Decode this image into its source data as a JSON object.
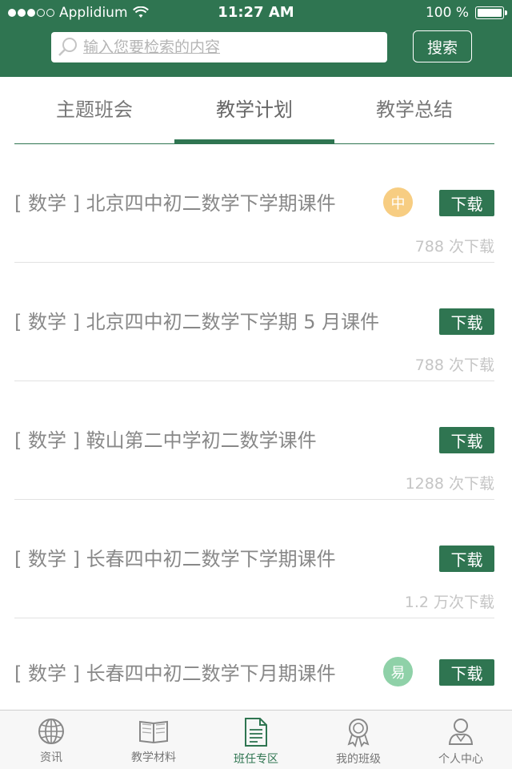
{
  "status_bar": {
    "carrier": "Applidium",
    "time": "11:27 AM",
    "battery": "100 %",
    "battery_level": 1.0,
    "signal_bars_filled": 3,
    "signal_bars_total": 5
  },
  "search": {
    "placeholder": "输入您要检索的内容",
    "button_label": "搜索"
  },
  "tabs": [
    {
      "label": "主题班会",
      "active": false
    },
    {
      "label": "教学计划",
      "active": true
    },
    {
      "label": "教学总结",
      "active": false
    }
  ],
  "list": [
    {
      "title": "[ 数学 ] 北京四中初二数学下学期课件",
      "badge": "中",
      "badge_color": "#f7cd82",
      "download_label": "下载",
      "count": "788 次下载"
    },
    {
      "title": "[ 数学 ] 北京四中初二数学下学期 5 月课件",
      "badge": "",
      "badge_color": "",
      "download_label": "下载",
      "count": "788 次下载"
    },
    {
      "title": "[ 数学 ] 鞍山第二中学初二数学课件",
      "badge": "",
      "badge_color": "",
      "download_label": "下载",
      "count": "1288 次下载"
    },
    {
      "title": "[ 数学 ] 长春四中初二数学下学期课件",
      "badge": "",
      "badge_color": "",
      "download_label": "下载",
      "count": "1.2 万次下载"
    },
    {
      "title": "[ 数学 ] 长春四中初二数学下月期课件",
      "badge": "易",
      "badge_color": "#8fd1a8",
      "download_label": "下载",
      "count": ""
    }
  ],
  "bottom_nav": [
    {
      "label": "资讯",
      "icon": "globe-icon",
      "active": false
    },
    {
      "label": "教学材料",
      "icon": "book-icon",
      "active": false
    },
    {
      "label": "班任专区",
      "icon": "document-icon",
      "active": true
    },
    {
      "label": "我的班级",
      "icon": "award-icon",
      "active": false
    },
    {
      "label": "个人中心",
      "icon": "user-icon",
      "active": false
    }
  ],
  "colors": {
    "brand": "#2f7551",
    "badge_medium": "#f7cd82",
    "badge_easy": "#8fd1a8"
  }
}
